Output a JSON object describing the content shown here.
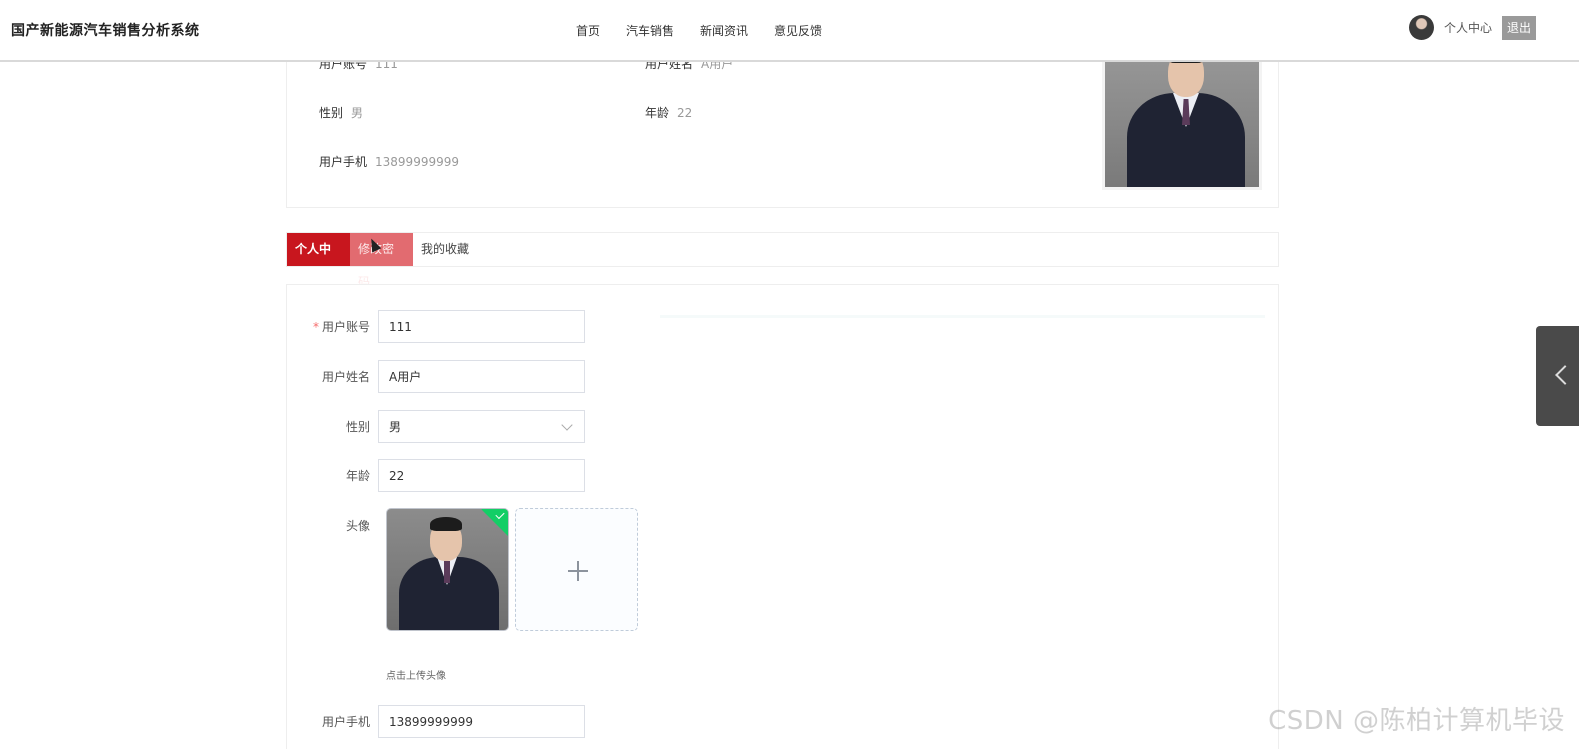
{
  "header": {
    "brand": "国产新能源汽车销售分析系统",
    "nav": [
      "首页",
      "汽车销售",
      "新闻资讯",
      "意见反馈"
    ],
    "user_center": "个人中心",
    "logout": "退出"
  },
  "profile": {
    "account_label": "用户账号",
    "account_value": "111",
    "name_label": "用户姓名",
    "name_value": "A用户",
    "gender_label": "性别",
    "gender_value": "男",
    "age_label": "年龄",
    "age_value": "22",
    "phone_label": "用户手机",
    "phone_value": "13899999999"
  },
  "tabs": [
    "个人中心",
    "修改密码",
    "我的收藏"
  ],
  "form": {
    "account_label": "用户账号",
    "account_value": "111",
    "name_label": "用户姓名",
    "name_value": "A用户",
    "gender_label": "性别",
    "gender_value": "男",
    "age_label": "年龄",
    "age_value": "22",
    "avatar_label": "头像",
    "upload_hint": "点击上传头像",
    "phone_label": "用户手机",
    "phone_value": "13899999999"
  },
  "watermark": "CSDN @陈柏计算机毕设",
  "colors": {
    "primary": "#c8161e",
    "tab_hover": "#e26b70",
    "success": "#13ce66"
  }
}
